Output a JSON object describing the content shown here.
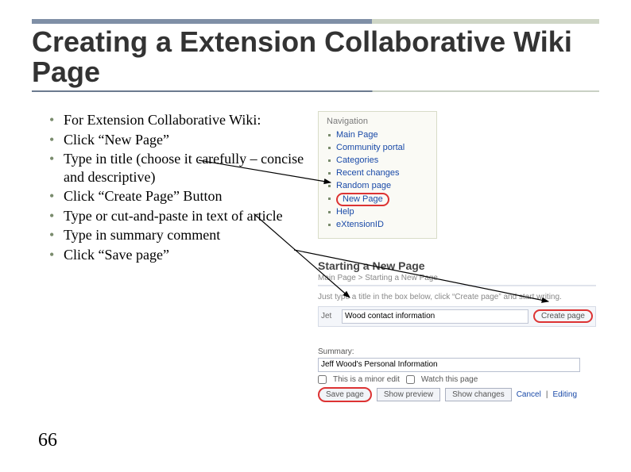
{
  "title": "Creating a Extension Collaborative Wiki Page",
  "page_number": "66",
  "bullets": [
    "For Extension Collaborative Wiki:",
    "Click “New Page”",
    "Type in title (choose it carefully – concise and descriptive)",
    "Click “Create Page” Button",
    "Type or cut-and-paste in text of article",
    "Type in summary comment",
    "Click “Save page”"
  ],
  "nav": {
    "heading": "Navigation",
    "items": [
      "Main Page",
      "Community portal",
      "Categories",
      "Recent changes",
      "Random page",
      "New Page",
      "Help",
      "eXtensionID"
    ]
  },
  "start": {
    "heading": "Starting a New Page",
    "breadcrumb": "Main Page > Starting a New Page",
    "instruction": "Just type a title in the box below, click “Create page” and start writing.",
    "field_name": "Jet",
    "field_value": "Wood contact information",
    "create_btn": "Create page"
  },
  "summary": {
    "label": "Summary:",
    "value": "Jeff Wood's Personal Information",
    "minor": "This is a minor edit",
    "watch": "Watch this page",
    "save": "Save page",
    "preview": "Show preview",
    "changes": "Show changes",
    "cancel": "Cancel",
    "editing": "Editing"
  }
}
